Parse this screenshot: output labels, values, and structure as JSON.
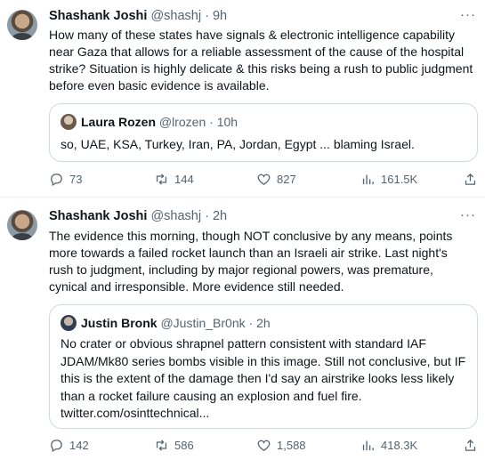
{
  "tweets": [
    {
      "author": "Shashank Joshi",
      "handle": "@shashj",
      "sep": "·",
      "time": "9h",
      "more": "···",
      "text": "How many of these states have signals & electronic intelligence capability near Gaza that allows for a reliable assessment of the cause of the hospital strike? Situation is highly delicate & this risks being a rush to public judgment before even basic evidence is available.",
      "quote": {
        "author": "Laura Rozen",
        "handle": "@lrozen",
        "sep": "·",
        "time": "10h",
        "text": "so, UAE, KSA, Turkey, Iran, PA, Jordan, Egypt ... blaming Israel."
      },
      "replies": "73",
      "retweets": "144",
      "likes": "827",
      "views": "161.5K"
    },
    {
      "author": "Shashank Joshi",
      "handle": "@shashj",
      "sep": "·",
      "time": "2h",
      "more": "···",
      "text": "The evidence this morning, though NOT conclusive by any means, points more towards a failed rocket launch than an Israeli air strike. Last night's rush to judgment, including by major regional powers, was premature, cynical and irresponsible. More evidence still needed.",
      "quote": {
        "author": "Justin Bronk",
        "handle": "@Justin_Br0nk",
        "sep": "·",
        "time": "2h",
        "text": "No crater or obvious shrapnel pattern consistent with standard IAF JDAM/Mk80 series bombs visible in this image. Still not conclusive, but IF this is the extent of the damage then I'd say an airstrike looks less likely than a rocket failure causing an explosion and fuel fire. twitter.com/osinttechnical..."
      },
      "replies": "142",
      "retweets": "586",
      "likes": "1,588",
      "views": "418.3K"
    }
  ],
  "icons": [
    "reply-icon",
    "retweet-icon",
    "like-icon",
    "views-icon",
    "share-icon",
    "more-icon"
  ],
  "colors": {
    "text": "#0f1419",
    "muted": "#536471",
    "border": "#cfd9de"
  }
}
